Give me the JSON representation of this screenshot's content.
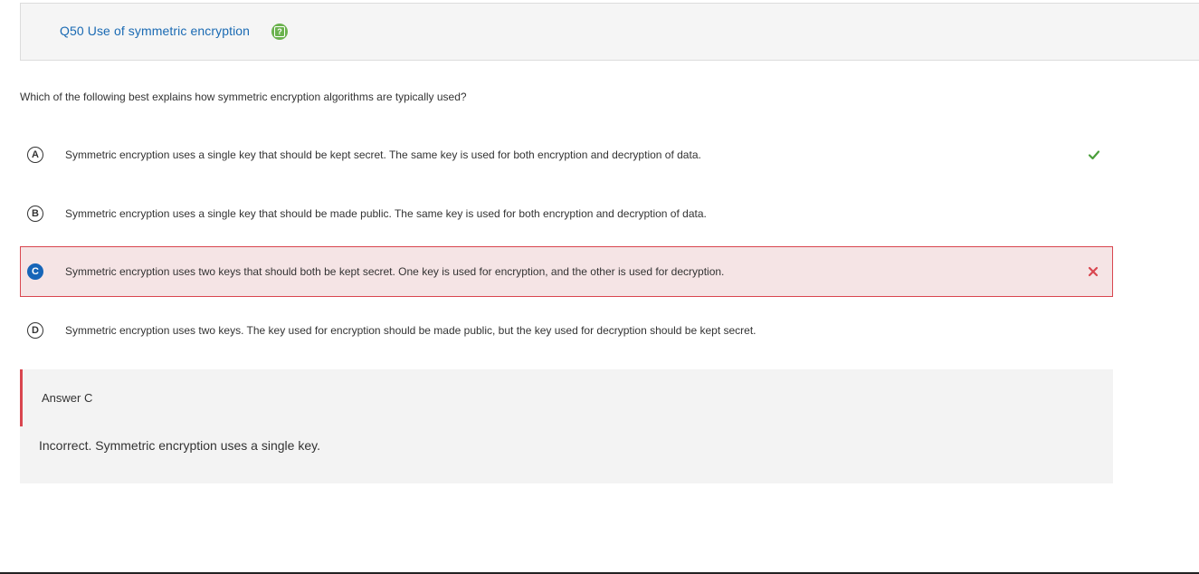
{
  "header": {
    "title": "Q50 Use of symmetric encryption",
    "help_icon": "question-mark-icon",
    "help_icon_glyph": "?"
  },
  "question": {
    "prompt": "Which of the following best explains how symmetric encryption algorithms are typically used?"
  },
  "choices": [
    {
      "letter": "A",
      "text": "Symmetric encryption uses a single key that should be kept secret. The same key is used for both encryption and decryption of data.",
      "status": "correct"
    },
    {
      "letter": "B",
      "text": "Symmetric encryption uses a single key that should be made public. The same key is used for both encryption and decryption of data.",
      "status": "none"
    },
    {
      "letter": "C",
      "text": "Symmetric encryption uses two keys that should both be kept secret. One key is used for encryption, and the other is used for decryption.",
      "status": "incorrect-selected"
    },
    {
      "letter": "D",
      "text": "Symmetric encryption uses two keys. The key used for encryption should be made public, but the key used for decryption should be kept secret.",
      "status": "none"
    }
  ],
  "answer": {
    "label": "Answer C",
    "feedback": "Incorrect. Symmetric encryption uses a single key."
  },
  "colors": {
    "title_blue": "#1a6ab3",
    "help_green": "#6bb24e",
    "correct_green": "#4a9e3a",
    "incorrect_red": "#d9464f",
    "selected_blue": "#1665b8",
    "selected_bg": "#f5e4e5",
    "panel_bg": "#f3f3f3"
  }
}
